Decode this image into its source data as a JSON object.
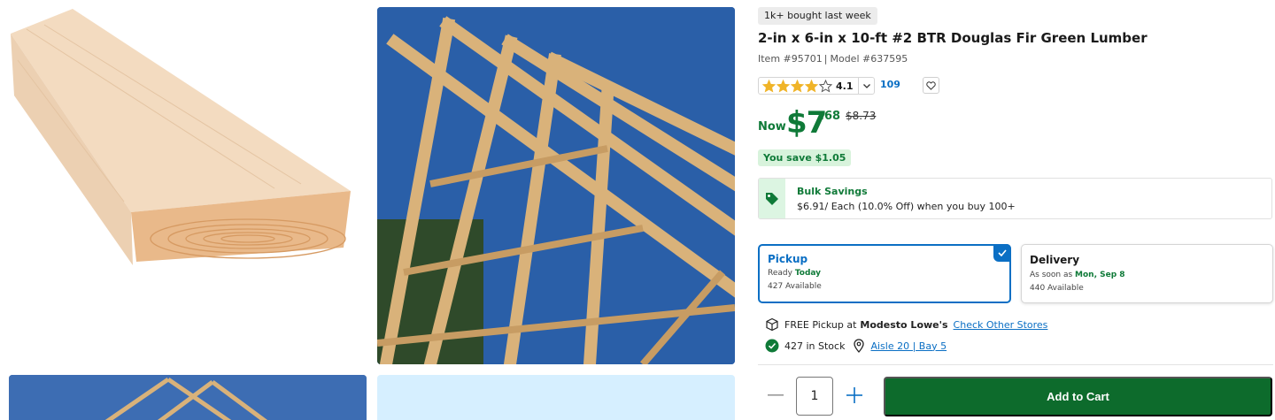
{
  "product": {
    "bought_badge": "1k+ bought last week",
    "title": "2-in x 6-in x 10-ft #2 BTR Douglas Fir Green Lumber",
    "item_number": "Item #95701",
    "model_number": "Model #637595"
  },
  "rating": {
    "value": "4.1",
    "stars": 4.1,
    "review_count": "109",
    "icons": {
      "star": "star-icon",
      "caret": "chevron-down-icon",
      "favorite": "heart-icon"
    }
  },
  "price": {
    "now_label": "Now",
    "dollars": "$7",
    "cents": ".68",
    "was": "$8.73",
    "you_save": "You save $1.05"
  },
  "bulk": {
    "title": "Bulk Savings",
    "text": "$6.91/ Each (10.0% Off) when you buy 100+",
    "icon": "price-tag-icon"
  },
  "fulfillment": {
    "pickup": {
      "title": "Pickup",
      "ready_prefix": "Ready ",
      "ready_day": "Today",
      "available": "427 Available",
      "selected": true
    },
    "delivery": {
      "title": "Delivery",
      "soon_prefix": "As soon as ",
      "soon_date": "Mon, Sep 8",
      "available": "440 Available"
    }
  },
  "store": {
    "pickup_prefix": "FREE Pickup at",
    "store_name": "Modesto Lowe's",
    "check_other": "Check Other Stores",
    "in_stock": "427 in Stock",
    "aisle": "Aisle 20 | Bay 5"
  },
  "cart": {
    "quantity": "1",
    "add_label": "Add to Cart"
  },
  "colors": {
    "brand_green": "#0f7a38",
    "cart_green": "#0d6b2c",
    "link_blue": "#0b6fc4",
    "star_gold": "#f0b428"
  }
}
